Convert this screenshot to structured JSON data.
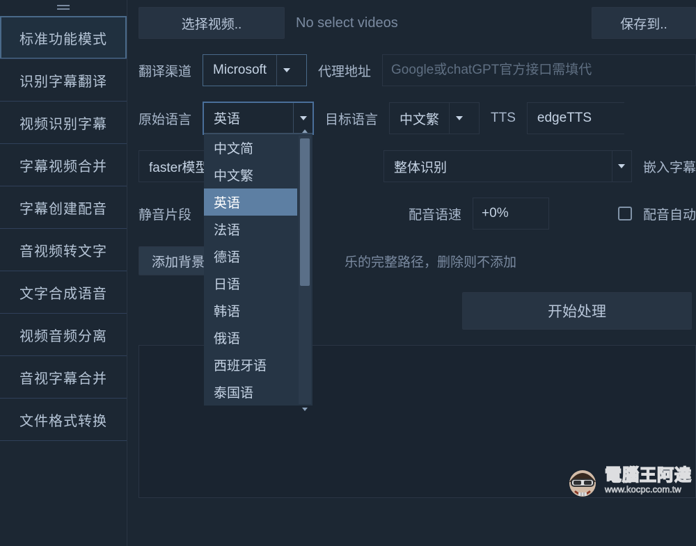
{
  "sidebar": {
    "items": [
      "标准功能模式",
      "识别字幕翻译",
      "视频识别字幕",
      "字幕视频合并",
      "字幕创建配音",
      "音视频转文字",
      "文字合成语音",
      "视频音频分离",
      "音视字幕合并",
      "文件格式转换"
    ],
    "selected_index": 0
  },
  "top": {
    "select_video": "选择视频..",
    "status": "No select videos",
    "save_to": "保存到.."
  },
  "row_channel": {
    "label": "翻译渠道",
    "value": "Microsoft",
    "proxy_label": "代理地址",
    "proxy_placeholder": "Google或chatGPT官方接口需填代"
  },
  "row_lang": {
    "src_label": "原始语言",
    "src_value": "英语",
    "tgt_label": "目标语言",
    "tgt_value": "中文繁",
    "tts_label": "TTS",
    "tts_value": "edgeTTS"
  },
  "src_lang_options": [
    "中文简",
    "中文繁",
    "英语",
    "法语",
    "德语",
    "日语",
    "韩语",
    "俄语",
    "西班牙语",
    "泰国语"
  ],
  "src_lang_highlight": "英语",
  "row_recog": {
    "model_value": "faster模型",
    "mode_value": "整体识别",
    "embed_label": "嵌入字幕"
  },
  "row_silence": {
    "label": "静音片段",
    "speed_label": "配音语速",
    "speed_value": "+0%",
    "auto_label": "配音自动"
  },
  "row_bg": {
    "button": "添加背景",
    "placeholder": "乐的完整路径，删除则不添加"
  },
  "actions": {
    "start": "开始处理"
  },
  "watermark": {
    "title": "電腦王阿達",
    "url": "www.kocpc.com.tw"
  }
}
